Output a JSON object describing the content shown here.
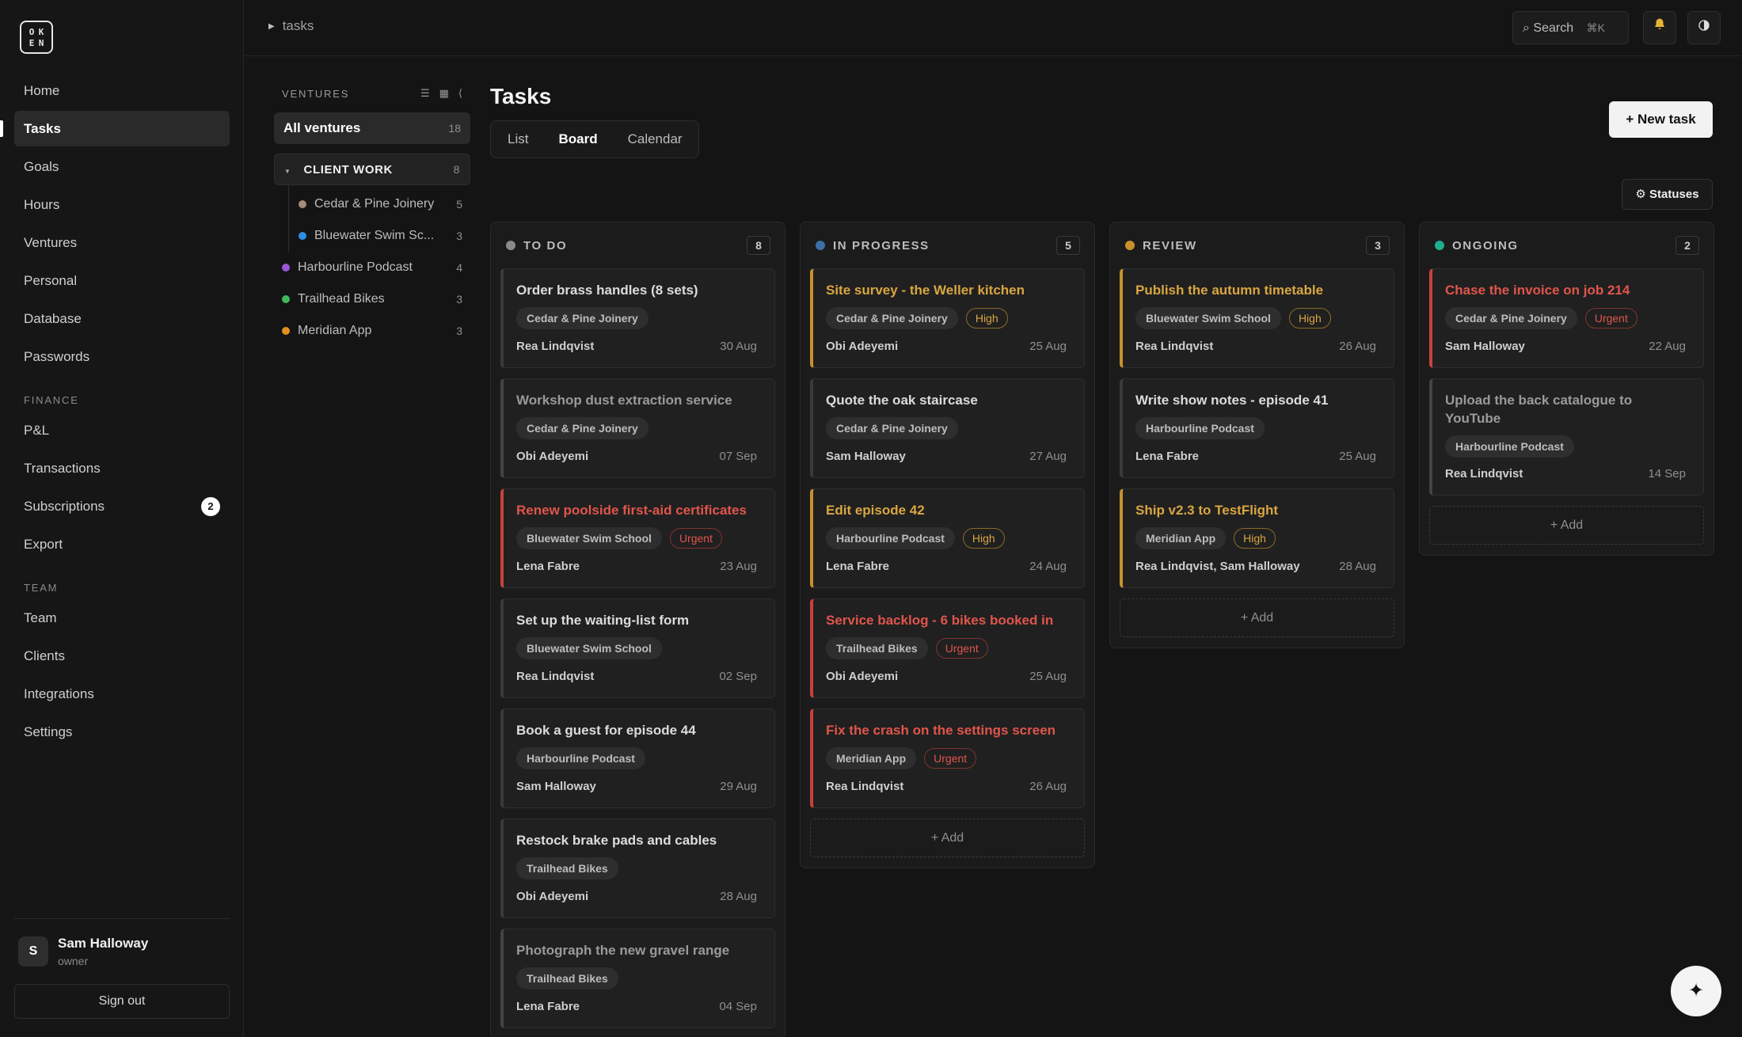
{
  "logo": {
    "letters": [
      "O",
      "K",
      "E",
      "N"
    ]
  },
  "nav": {
    "main": [
      "Home",
      "Tasks",
      "Goals",
      "Hours",
      "Ventures",
      "Personal",
      "Database",
      "Passwords"
    ],
    "finance_label": "FINANCE",
    "finance": [
      "P&L",
      "Transactions",
      "Subscriptions",
      "Export"
    ],
    "subscriptions_badge": "2",
    "team_label": "TEAM",
    "team": [
      "Team",
      "Clients",
      "Integrations",
      "Settings"
    ]
  },
  "user": {
    "initial": "S",
    "name": "Sam Halloway",
    "role": "owner",
    "signout": "Sign out"
  },
  "topbar": {
    "breadcrumb": "tasks",
    "search_label": "Search",
    "search_shortcut": "⌘K"
  },
  "ventures": {
    "heading": "VENTURES",
    "all_label": "All ventures",
    "all_count": "18",
    "group_label": "CLIENT WORK",
    "group_count": "8",
    "group_items": [
      {
        "name": "Cedar & Pine Joinery",
        "count": "5",
        "color": "#a88a7a"
      },
      {
        "name": "Bluewater Swim Sc...",
        "count": "3",
        "color": "#2d8fe0"
      }
    ],
    "items": [
      {
        "name": "Harbourline Podcast",
        "count": "4",
        "color": "#9a56d6"
      },
      {
        "name": "Trailhead Bikes",
        "count": "3",
        "color": "#3fb85a"
      },
      {
        "name": "Meridian App",
        "count": "3",
        "color": "#e2901f"
      }
    ]
  },
  "main": {
    "title": "Tasks",
    "tabs": [
      "List",
      "Board",
      "Calendar"
    ],
    "new_task": "+ New task",
    "statuses": "⚙ Statuses",
    "add_label": "+ Add"
  },
  "columns": [
    {
      "title": "TO DO",
      "count": "8",
      "color": "#8a8a8a",
      "cards": [
        {
          "title": "Order brass handles (8 sets)",
          "tag": "Cedar & Pine Joinery",
          "assignee": "Rea Lindqvist",
          "due": "30 Aug",
          "style": "normal"
        },
        {
          "title": "Workshop dust extraction service",
          "tag": "Cedar & Pine Joinery",
          "assignee": "Obi Adeyemi",
          "due": "07 Sep",
          "style": "faded"
        },
        {
          "title": "Renew poolside first-aid certificates",
          "tag": "Bluewater Swim School",
          "priority": "Urgent",
          "assignee": "Lena Fabre",
          "due": "23 Aug",
          "style": "urgent"
        },
        {
          "title": "Set up the waiting-list form",
          "tag": "Bluewater Swim School",
          "assignee": "Rea Lindqvist",
          "due": "02 Sep",
          "style": "normal"
        },
        {
          "title": "Book a guest for episode 44",
          "tag": "Harbourline Podcast",
          "assignee": "Sam Halloway",
          "due": "29 Aug",
          "style": "normal"
        },
        {
          "title": "Restock brake pads and cables",
          "tag": "Trailhead Bikes",
          "assignee": "Obi Adeyemi",
          "due": "28 Aug",
          "style": "normal"
        },
        {
          "title": "Photograph the new gravel range",
          "tag": "Trailhead Bikes",
          "assignee": "Lena Fabre",
          "due": "04 Sep",
          "style": "faded"
        }
      ]
    },
    {
      "title": "IN PROGRESS",
      "count": "5",
      "color": "#3d6ea8",
      "cards": [
        {
          "title": "Site survey - the Weller kitchen",
          "tag": "Cedar & Pine Joinery",
          "priority": "High",
          "assignee": "Obi Adeyemi",
          "due": "25 Aug",
          "style": "high"
        },
        {
          "title": "Quote the oak staircase",
          "tag": "Cedar & Pine Joinery",
          "assignee": "Sam Halloway",
          "due": "27 Aug",
          "style": "normal"
        },
        {
          "title": "Edit episode 42",
          "tag": "Harbourline Podcast",
          "priority": "High",
          "assignee": "Lena Fabre",
          "due": "24 Aug",
          "style": "high"
        },
        {
          "title": "Service backlog - 6 bikes booked in",
          "tag": "Trailhead Bikes",
          "priority": "Urgent",
          "assignee": "Obi Adeyemi",
          "due": "25 Aug",
          "style": "urgent"
        },
        {
          "title": "Fix the crash on the settings screen",
          "tag": "Meridian App",
          "priority": "Urgent",
          "assignee": "Rea Lindqvist",
          "due": "26 Aug",
          "style": "urgent"
        }
      ]
    },
    {
      "title": "REVIEW",
      "count": "3",
      "color": "#c7912f",
      "cards": [
        {
          "title": "Publish the autumn timetable",
          "tag": "Bluewater Swim School",
          "priority": "High",
          "assignee": "Rea Lindqvist",
          "due": "26 Aug",
          "style": "high"
        },
        {
          "title": "Write show notes - episode 41",
          "tag": "Harbourline Podcast",
          "assignee": "Lena Fabre",
          "due": "25 Aug",
          "style": "normal"
        },
        {
          "title": "Ship v2.3 to TestFlight",
          "tag": "Meridian App",
          "priority": "High",
          "assignee": "Rea Lindqvist, Sam Halloway",
          "due": "28 Aug",
          "style": "high"
        }
      ]
    },
    {
      "title": "ONGOING",
      "count": "2",
      "color": "#1fae8f",
      "cards": [
        {
          "title": "Chase the invoice on job 214",
          "tag": "Cedar & Pine Joinery",
          "priority": "Urgent",
          "assignee": "Sam Halloway",
          "due": "22 Aug",
          "style": "urgent"
        },
        {
          "title": "Upload the back catalogue to YouTube",
          "tag": "Harbourline Podcast",
          "assignee": "Rea Lindqvist",
          "due": "14 Sep",
          "style": "faded",
          "tall": true
        }
      ]
    }
  ],
  "fab_icon": "sparkle-icon",
  "colors": {
    "accent_high": "#d9a640",
    "accent_urgent": "#e0554c"
  }
}
